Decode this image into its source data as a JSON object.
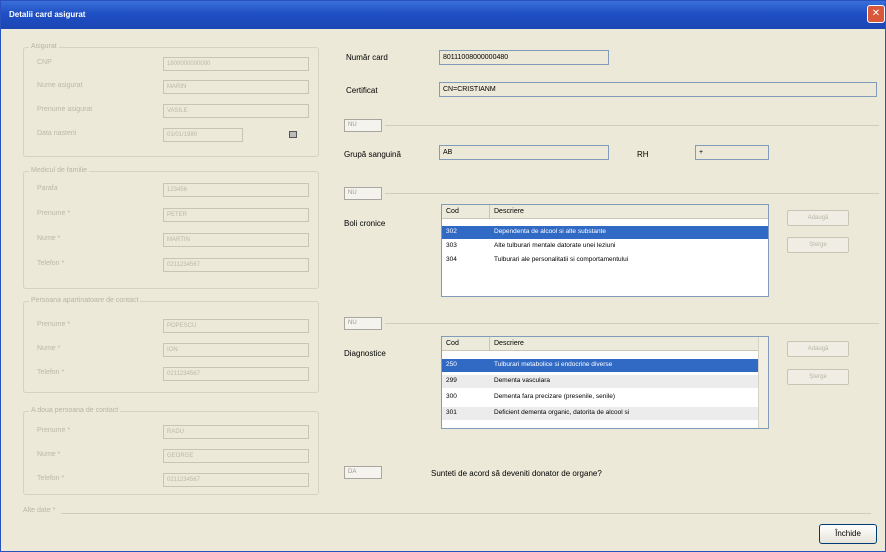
{
  "window": {
    "title": "Detalii card asigurat",
    "close_glyph": "✕"
  },
  "left": {
    "insured": {
      "group_label": "Asigurat",
      "fields": [
        {
          "label": "CNP",
          "value": "1800000000000"
        },
        {
          "label": "Nume asigurat",
          "value": "MARIN"
        },
        {
          "label": "Prenume asigurat",
          "value": "VASILE"
        },
        {
          "label": "Data nasterii",
          "value": "01/01/1980"
        }
      ]
    },
    "family_doctor": {
      "group_label": "Medicul de familie",
      "fields": [
        {
          "label": "Parafa",
          "value": "123456"
        },
        {
          "label": "Prenume *",
          "value": "PETER"
        },
        {
          "label": "Nume *",
          "value": "MARTIN"
        },
        {
          "label": "Telefon *",
          "value": "0211234567"
        }
      ]
    },
    "contact_person_1": {
      "group_label": "Persoana apartinatoare de contact",
      "fields": [
        {
          "label": "Prenume *",
          "value": "POPESCU"
        },
        {
          "label": "Nume *",
          "value": "ION"
        },
        {
          "label": "Telefon *",
          "value": "0211234567"
        }
      ]
    },
    "contact_person_2": {
      "group_label": "A doua persoana de contact",
      "fields": [
        {
          "label": "Prenume *",
          "value": "RADU"
        },
        {
          "label": "Nume *",
          "value": "GEORGE"
        },
        {
          "label": "Telefon *",
          "value": "0211234567"
        }
      ]
    },
    "bottom_label": "Alte date *"
  },
  "right": {
    "card_number_label": "Număr card",
    "card_number_value": "80111008000000480",
    "certificate_label": "Certificat",
    "certificate_value": "CN=CRISTIANM",
    "blood": {
      "tag": "NU",
      "group_label": "Grupă sanguină",
      "group_value": "AB",
      "rh_label": "RH",
      "rh_value": "+"
    },
    "chronic": {
      "tag": "NU",
      "label": "Boli cronice",
      "col_code": "Cod",
      "col_desc": "Descriere",
      "rows": [
        {
          "code": "302",
          "desc": "Dependenta de alcool si alte substante",
          "selected": true
        },
        {
          "code": "303",
          "desc": "Alte tulburari mentale datorate unei leziuni",
          "selected": false
        },
        {
          "code": "304",
          "desc": "Tulburari ale personalitatii si comportamentului",
          "selected": false
        }
      ],
      "add_button": "Adaugă",
      "delete_button": "Șterge"
    },
    "diagnoses": {
      "tag": "NU",
      "label": "Diagnostice",
      "col_code": "Cod",
      "col_desc": "Descriere",
      "rows": [
        {
          "code": "250",
          "desc": "Tulburari metabolice si endocrine diverse",
          "selected": true
        },
        {
          "code": "299",
          "desc": "Dementa vasculara",
          "selected": false
        },
        {
          "code": "300",
          "desc": "Dementa fara precizare (presenile, senile)",
          "selected": false
        },
        {
          "code": "301",
          "desc": "Deficient dementa organic, datorita de alcool si",
          "selected": false
        }
      ],
      "add_button": "Adaugă",
      "delete_button": "Șterge"
    },
    "organ_donor": {
      "tag": "DA",
      "question": "Sunteti de acord să deveniti donator de organe?"
    },
    "close_button": "Închide"
  }
}
